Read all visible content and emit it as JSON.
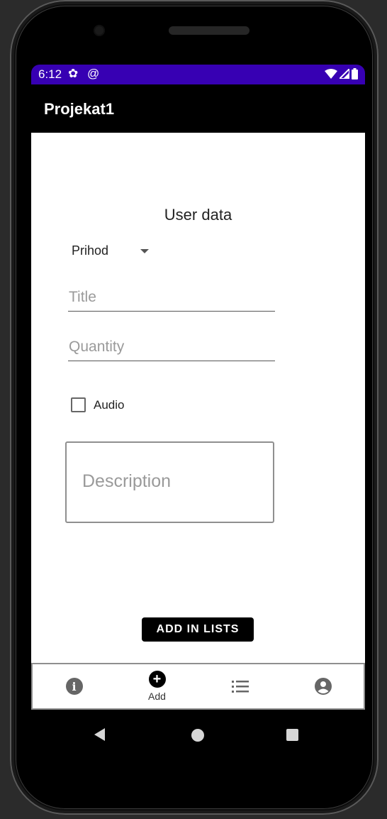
{
  "status_bar": {
    "time": "6:12",
    "gear_glyph": "✿",
    "at_glyph": "@",
    "accent_color": "#3700b3"
  },
  "app_bar": {
    "title": "Projekat1"
  },
  "form": {
    "title": "User data",
    "spinner_value": "Prihod",
    "title_placeholder": "Title",
    "quantity_placeholder": "Quantity",
    "checkbox_label": "Audio",
    "description_placeholder": "Description",
    "button_label": "ADD IN LISTS"
  },
  "bottom_nav": {
    "items": [
      {
        "icon": "info-icon",
        "glyph": "i",
        "label": ""
      },
      {
        "icon": "add-circle-icon",
        "glyph": "+",
        "label": "Add"
      },
      {
        "icon": "list-icon",
        "label": ""
      },
      {
        "icon": "account-circle-icon",
        "label": ""
      }
    ]
  },
  "system_nav": {
    "buttons": [
      "back-icon",
      "home-icon",
      "recents-icon"
    ]
  }
}
